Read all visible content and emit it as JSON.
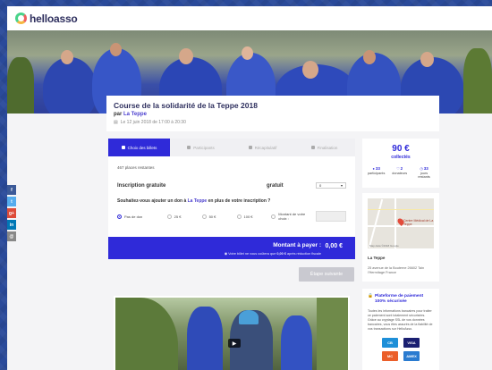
{
  "brand": {
    "logo_text": "helloasso"
  },
  "event": {
    "title": "Course de la solidarité de la Teppe 2018",
    "by_prefix": "par",
    "organizer": "La Teppe",
    "date": "Le 12 juin 2018 de 17:00 à 20:30"
  },
  "steps": [
    {
      "label": "Choix des billets"
    },
    {
      "label": "Participants"
    },
    {
      "label": "Récapitulatif"
    },
    {
      "label": "Finalisation"
    }
  ],
  "ticketing": {
    "places_left": "467 places restantes",
    "ticket_name": "Inscription gratuite",
    "ticket_price": "gratuit",
    "qty_value": "0",
    "donation_q_pre": "Souhaitez-vous ajouter un don à",
    "donation_q_org": "La Teppe",
    "donation_q_post": "en plus de votre inscription ?",
    "options": [
      "Pas de don",
      "25 €",
      "50 €",
      "100 €",
      "Montant de votre choix :"
    ],
    "selected_option": "Pas de don"
  },
  "payment": {
    "label": "Montant à payer :",
    "amount": "0,00 €",
    "note_pre": "Votre billet ne vous coûtera que",
    "note_amount": "0,00 €",
    "note_post": "après réduction fiscale",
    "next_button": "Étape suivante"
  },
  "collect": {
    "amount": "90 €",
    "amount_label": "collectés",
    "stats": [
      {
        "value": "33",
        "label": "participants",
        "icon": "users-icon"
      },
      {
        "value": "2",
        "label": "donateurs",
        "icon": "heart-icon"
      },
      {
        "value": "33",
        "label": "jours restants",
        "icon": "clock-icon"
      }
    ]
  },
  "location": {
    "map_pin_label": "Centre Médical de La Teppe",
    "map_credit": "Map data ©2018 Google",
    "name": "La Teppe",
    "address": "25 avenue de la Bouterne 26602 Tain l'Hermitage France"
  },
  "security": {
    "title": "Plateforme de paiement 100% sécurisée",
    "text": "Toutes les informations bancaires pour traiter ce paiement sont totalement sécurisées. Grâce au cryptage SSL de vos données bancaires, vous êtes assurés de la fiabilité de vos transactions sur HelloAsso.",
    "cards": [
      "CB",
      "VISA",
      "MC",
      "AMEX"
    ]
  },
  "share": [
    "f",
    "t",
    "g+",
    "in",
    "@"
  ],
  "colors": {
    "primary": "#2f2ad9",
    "dark_text": "#2e2f5e",
    "panel_bg": "#f4f4f6"
  }
}
